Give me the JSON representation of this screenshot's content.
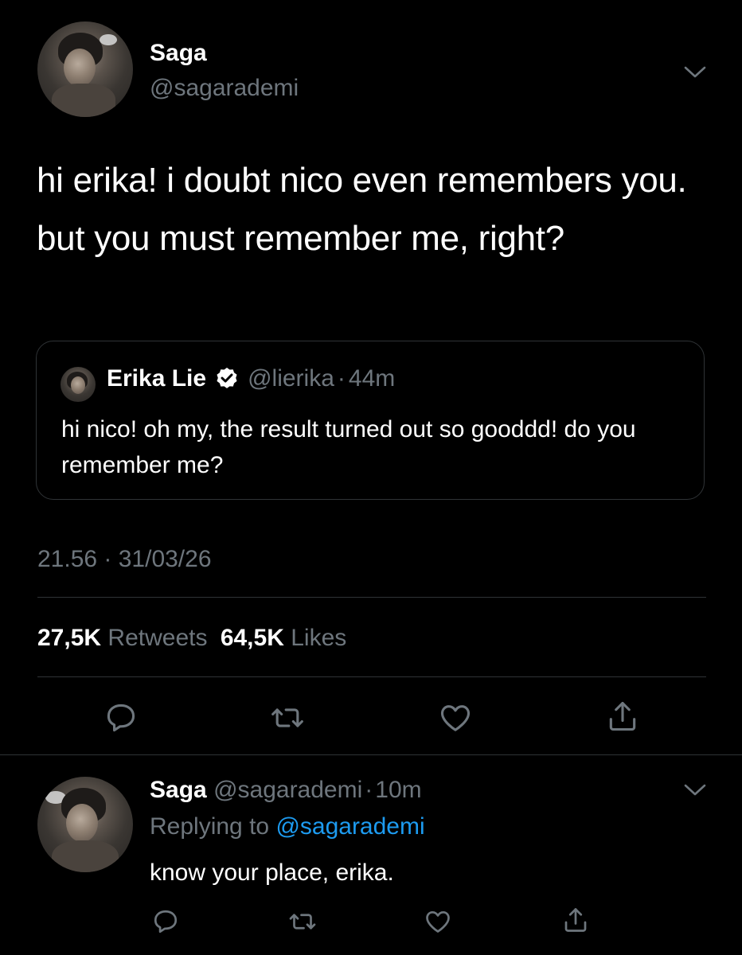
{
  "tweet": {
    "author_name": "Saga",
    "author_handle": "@sagarademi",
    "text": "hi erika! i doubt nico even remembers you. but you must remember me, right?",
    "time": "21.56 · 31/03/26",
    "retweets_count": "27,5K",
    "retweets_label": "Retweets",
    "likes_count": "64,5K",
    "likes_label": "Likes"
  },
  "quote": {
    "author_name": "Erika Lie",
    "author_handle": "@lierika",
    "dot": "·",
    "age": "44m",
    "text": "hi nico! oh my, the result turned out so gooddd! do you remember me?"
  },
  "reply": {
    "author_name": "Saga",
    "author_handle": "@sagarademi",
    "dot": "·",
    "age": "10m",
    "replying_to_label": "Replying to",
    "replying_to_handle": "@sagarademi",
    "text": "know your place, erika."
  },
  "icons": {
    "more": "chevron-down-icon",
    "reply": "comment-icon",
    "retweet": "retweet-icon",
    "like": "heart-icon",
    "share": "share-icon",
    "verified": "verified-badge-icon"
  },
  "colors": {
    "background": "#000000",
    "text": "#ffffff",
    "secondary": "#6e767d",
    "link": "#1d9bf0",
    "divider": "#2f3336"
  }
}
